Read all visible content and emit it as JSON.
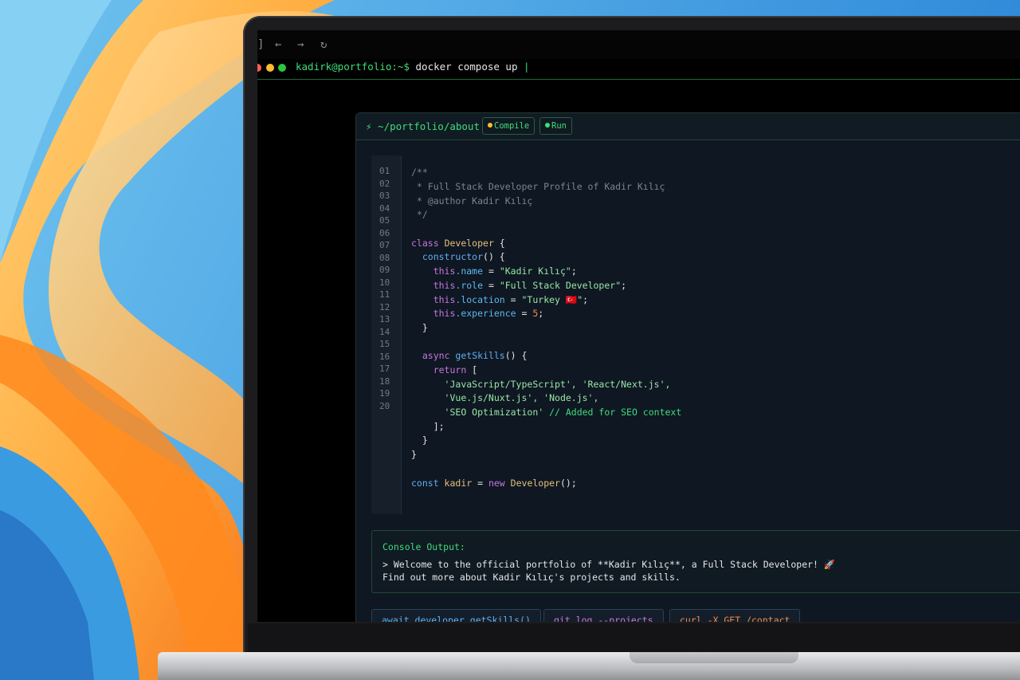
{
  "colors": {
    "accent": "#3fdc7a",
    "close": "#ff5f57",
    "minimize": "#febc2e",
    "maximize": "#28c840",
    "editor_bg": "#0f1722"
  },
  "browser": {
    "icons": [
      "sidebar-icon",
      "back-arrow-icon",
      "forward-arrow-icon",
      "reload-icon"
    ],
    "sidebar_glyph": "]",
    "back_glyph": "←",
    "forward_glyph": "→",
    "reload_glyph": "↻"
  },
  "terminal": {
    "prompt": "kadirk@portfolio:~$",
    "command": "docker compose up",
    "cursor": "|"
  },
  "editor": {
    "file_path": "⚡ ~/portfolio/about.js",
    "compile_label": "Compile",
    "run_label": "Run",
    "line_numbers": [
      "01",
      "02",
      "03",
      "04",
      "05",
      "06",
      "07",
      "08",
      "09",
      "10",
      "11",
      "12",
      "13",
      "14",
      "15",
      "16",
      "17",
      "18",
      "19",
      "20"
    ],
    "code": {
      "c1": "/**",
      "c2": " * Full Stack Developer Profile of Kadir Kılıç",
      "c3": " * @author Kadir Kılıç",
      "c4": " */",
      "class_kw": "class",
      "class_name": "Developer",
      "open_brace": " {",
      "ctor": "constructor",
      "ctor_tail": "() {",
      "this": "this",
      "name_prop": ".name",
      "name_val": "\"Kadir Kılıç\"",
      "role_prop": ".role",
      "role_val": "\"Full Stack Developer\"",
      "loc_prop": ".location",
      "loc_val": "\"Turkey 🇹🇷\"",
      "exp_prop": ".experience",
      "exp_val": "5",
      "eq": " = ",
      "semi": ";",
      "close_brace": "}",
      "async_kw": "async",
      "skills_fn": "getSkills",
      "fn_tail": "() {",
      "return_kw": "return",
      "open_bracket": " [",
      "skills_l1": "'JavaScript/TypeScript', 'React/Next.js',",
      "skills_l2": "'Vue.js/Nuxt.js', 'Node.js',",
      "skills_l3": "'SEO Optimization'",
      "skills_comment": " // Added for SEO context",
      "close_bracket": "];",
      "const_kw": "const",
      "var_name": " kadir",
      "new_kw": "new",
      "ctor_call": "Developer",
      "call_tail": "();"
    }
  },
  "console": {
    "title": "Console Output:",
    "line1": "> Welcome to the official portfolio of **Kadir Kılıç**, a Full Stack Developer! 🚀",
    "line2": "Find out more about Kadir Kılıç's projects and skills."
  },
  "actions": [
    {
      "label": "await developer.getSkills()",
      "color": "#61afef"
    },
    {
      "label": "git log --projects",
      "color": "#c678dd"
    },
    {
      "label": "curl -X GET /contact",
      "color": "#f08a4b"
    }
  ]
}
